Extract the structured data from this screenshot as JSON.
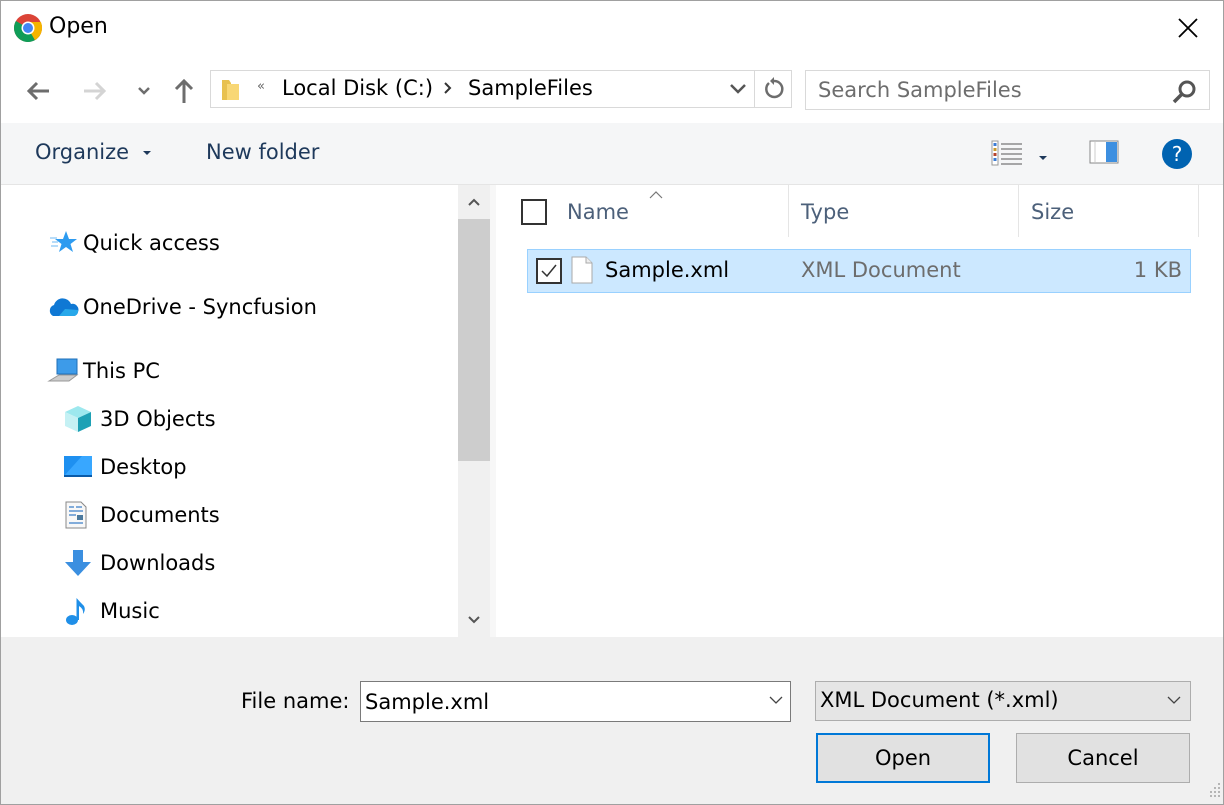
{
  "window": {
    "title": "Open",
    "app_icon": "chrome-icon",
    "close_icon": "close-icon"
  },
  "navigation": {
    "back_icon": "arrow-left-icon",
    "forward_icon": "arrow-right-icon",
    "recent_icon": "chevron-down-icon",
    "up_icon": "arrow-up-icon",
    "address": {
      "overflow_glyph": "«",
      "breadcrumbs": [
        "Local Disk (C:)",
        "SampleFiles"
      ],
      "separator_icon": "chevron-right-icon",
      "dropdown_icon": "chevron-down-icon",
      "refresh_icon": "refresh-icon"
    },
    "search": {
      "placeholder": "Search SampleFiles",
      "value": "",
      "icon": "search-icon"
    }
  },
  "command_bar": {
    "organize_label": "Organize",
    "new_folder_label": "New folder",
    "view_icon": "details-view-icon",
    "preview_pane_icon": "preview-pane-icon",
    "help_icon": "help-icon"
  },
  "nav_pane": {
    "items": [
      {
        "label": "Quick access",
        "icon": "quick-access-star-icon",
        "level": 0
      },
      {
        "label": "OneDrive - Syncfusion",
        "icon": "onedrive-cloud-icon",
        "level": 0
      },
      {
        "label": "This PC",
        "icon": "this-pc-icon",
        "level": 0
      },
      {
        "label": "3D Objects",
        "icon": "3d-objects-icon",
        "level": 1
      },
      {
        "label": "Desktop",
        "icon": "desktop-icon",
        "level": 1
      },
      {
        "label": "Documents",
        "icon": "documents-icon",
        "level": 1
      },
      {
        "label": "Downloads",
        "icon": "downloads-icon",
        "level": 1
      },
      {
        "label": "Music",
        "icon": "music-icon",
        "level": 1
      }
    ]
  },
  "file_list": {
    "columns": [
      "Name",
      "Type",
      "Size"
    ],
    "sorted_by": "Name",
    "rows": [
      {
        "name": "Sample.xml",
        "type": "XML Document",
        "size": "1 KB",
        "selected": true,
        "checked": true
      }
    ]
  },
  "footer": {
    "file_name_label": "File name:",
    "file_name_value": "Sample.xml",
    "filter_value": "XML Document (*.xml)",
    "open_label": "Open",
    "cancel_label": "Cancel"
  },
  "colors": {
    "selection_bg": "#cce8ff",
    "selection_border": "#99d1ff",
    "accent": "#0078d7",
    "command_text": "#1e395b"
  }
}
